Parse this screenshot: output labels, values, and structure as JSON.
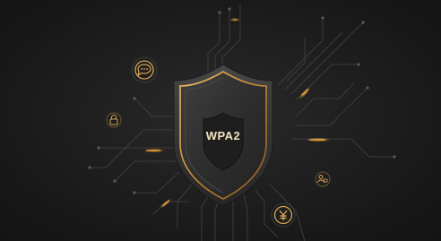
{
  "shield": {
    "label": "WPA2"
  },
  "icons": [
    {
      "name": "chat-bubble-icon"
    },
    {
      "name": "padlock-icon"
    },
    {
      "name": "user-lock-icon"
    },
    {
      "name": "yen-coin-icon"
    }
  ],
  "colors": {
    "background": "#1c1c1c",
    "accent_gold": "#d4a253",
    "accent_orange": "#f0a236",
    "shield_fill": "#3a3a3a",
    "circuit_line": "#4a4a4a",
    "label_text": "#f3e2bf"
  }
}
